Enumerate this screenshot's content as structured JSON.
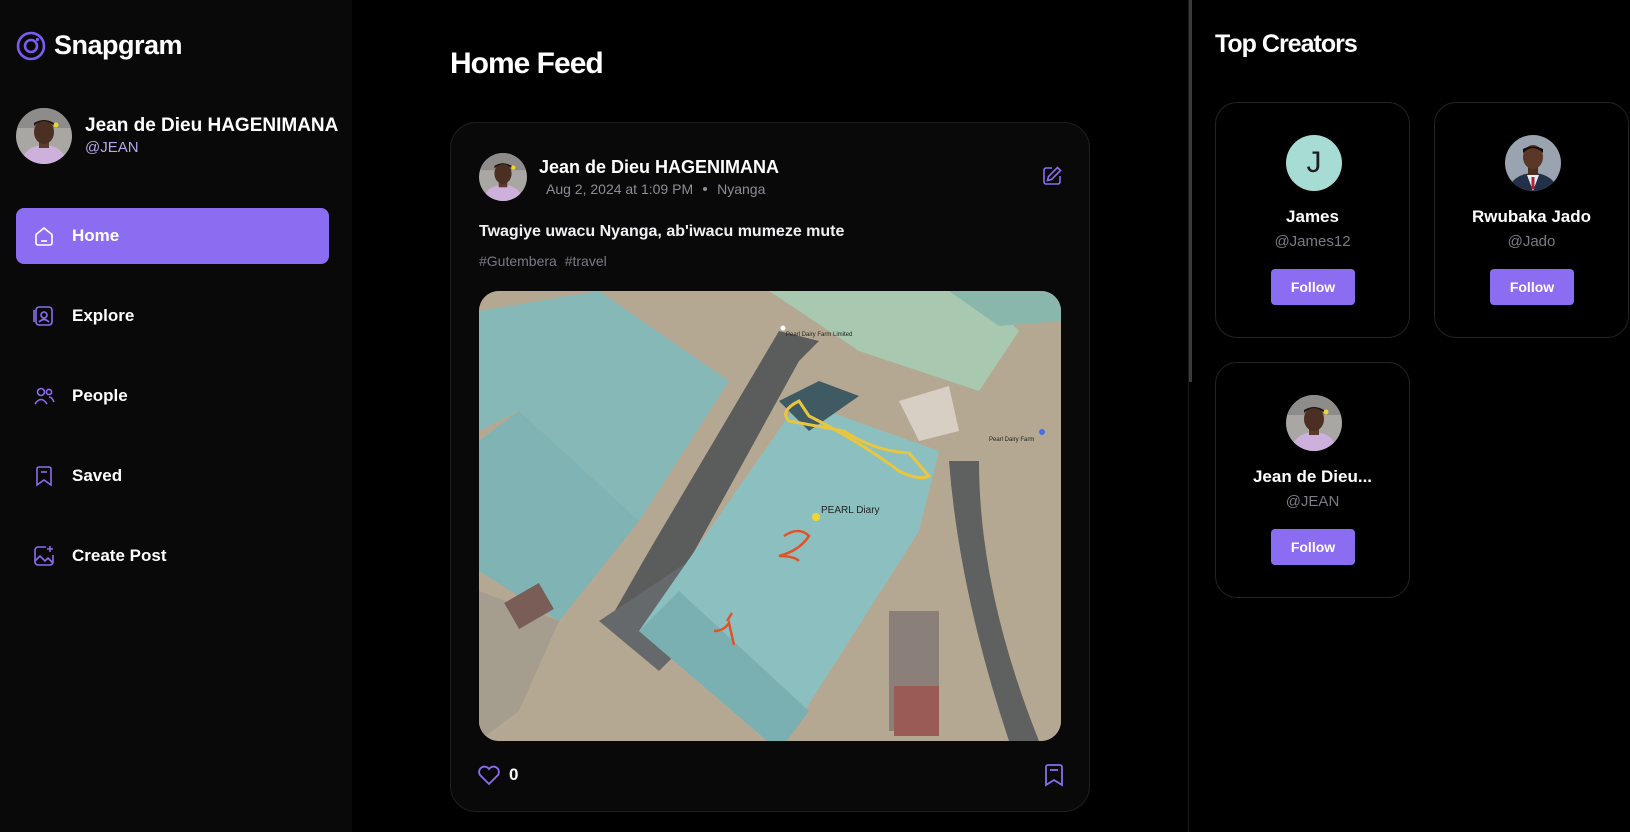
{
  "app": {
    "name": "Snapgram",
    "accent": "#8b6df2",
    "logo_icon": "instagram-ring-icon"
  },
  "user": {
    "name": "Jean de Dieu HAGENIMANA",
    "handle": "@JEAN"
  },
  "nav": {
    "items": [
      {
        "label": "Home",
        "icon": "home-icon",
        "active": true
      },
      {
        "label": "Explore",
        "icon": "explore-icon",
        "active": false
      },
      {
        "label": "People",
        "icon": "people-icon",
        "active": false
      },
      {
        "label": "Saved",
        "icon": "bookmark-icon",
        "active": false
      },
      {
        "label": "Create Post",
        "icon": "image-add-icon",
        "active": false
      }
    ]
  },
  "feed": {
    "title": "Home Feed",
    "post": {
      "author": "Jean de Dieu HAGENIMANA",
      "date": "Aug 2, 2024 at 1:09 PM",
      "location": "Nyanga",
      "caption": "Twagiye uwacu Nyanga, ab'iwacu mumeze mute",
      "tags": [
        "#Gutembera",
        "#travel"
      ],
      "image_labels": {
        "pin_main": "PEARL Diary",
        "pin_top": "Pearl Dairy Farm Limited",
        "pin_right": "Pearl Dairy Farm"
      },
      "likes": "0"
    }
  },
  "creators": {
    "title": "Top Creators",
    "items": [
      {
        "name": "James",
        "handle": "@James12",
        "initial": "J",
        "follow_label": "Follow"
      },
      {
        "name": "Rwubaka Jado",
        "handle": "@Jado",
        "follow_label": "Follow"
      },
      {
        "name": "Jean de Dieu...",
        "handle": "@JEAN",
        "follow_label": "Follow"
      }
    ]
  }
}
